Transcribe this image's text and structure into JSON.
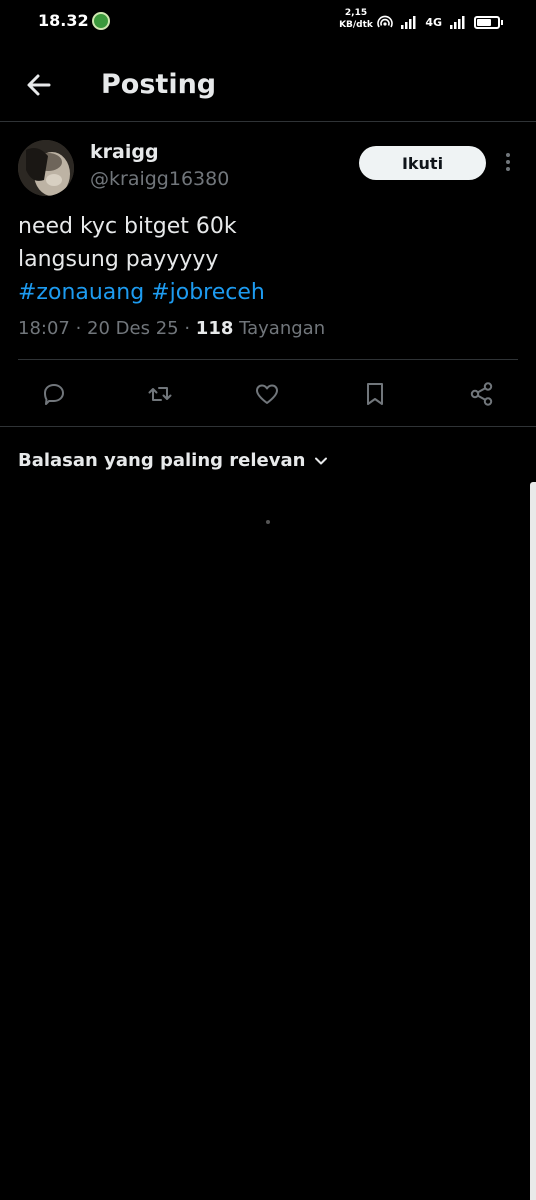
{
  "status_bar": {
    "time": "18.32",
    "net_speed_value": "2,15",
    "net_speed_unit": "KB/dtk",
    "network_type": "4G",
    "battery_level": 0.7
  },
  "header": {
    "title": "Posting"
  },
  "post": {
    "display_name": "kraigg",
    "handle": "@kraigg16380",
    "follow_label": "Ikuti",
    "text_line1": "need kyc bitget 60k",
    "text_line2": "langsung payyyyy",
    "hashtag1": "#zonauang",
    "hashtag2": "#jobreceh",
    "time": "18:07",
    "date": "20 Des 25",
    "views_count": "118",
    "views_label": "Tayangan"
  },
  "actions": {
    "icons": [
      "reply-icon",
      "repost-icon",
      "like-icon",
      "bookmark-icon",
      "share-icon"
    ]
  },
  "replies": {
    "sort_label": "Balasan yang paling relevan"
  },
  "colors": {
    "background": "#000000",
    "text_primary": "#e7e9ea",
    "text_secondary": "#71767b",
    "link": "#1d9bf0",
    "divider": "#2f3336",
    "follow_button_bg": "#eff3f4"
  }
}
